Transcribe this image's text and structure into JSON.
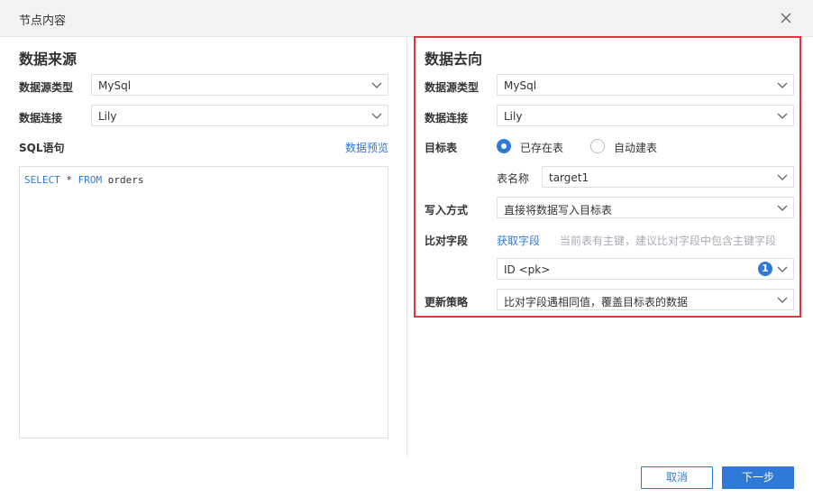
{
  "dialog": {
    "title": "节点内容",
    "close_icon": "close-icon"
  },
  "source": {
    "title": "数据来源",
    "type_label": "数据源类型",
    "type_value": "MySql",
    "conn_label": "数据连接",
    "conn_value": "Lily",
    "sql_label": "SQL语句",
    "preview_link": "数据预览",
    "sql": {
      "kw1": "SELECT",
      "mid": " * ",
      "kw2": "FROM",
      "rest": " orders"
    }
  },
  "target": {
    "title": "数据去向",
    "type_label": "数据源类型",
    "type_value": "MySql",
    "conn_label": "数据连接",
    "conn_value": "Lily",
    "table_label": "目标表",
    "radio_existing": "已存在表",
    "radio_auto": "自动建表",
    "table_name_label": "表名称",
    "table_name_value": "target1",
    "write_label": "写入方式",
    "write_value": "直接将数据写入目标表",
    "compare_label": "比对字段",
    "get_fields_link": "获取字段",
    "compare_hint": "当前表有主键，建议比对字段中包含主键字段",
    "compare_value": "ID <pk>",
    "compare_count": "1",
    "update_label": "更新策略",
    "update_value": "比对字段遇相同值，覆盖目标表的数据"
  },
  "footer": {
    "cancel": "取消",
    "next": "下一步"
  },
  "colors": {
    "accent": "#2f7ad8",
    "highlight_border": "#e0363d",
    "titlebar_bg": "#f2f3f5"
  }
}
